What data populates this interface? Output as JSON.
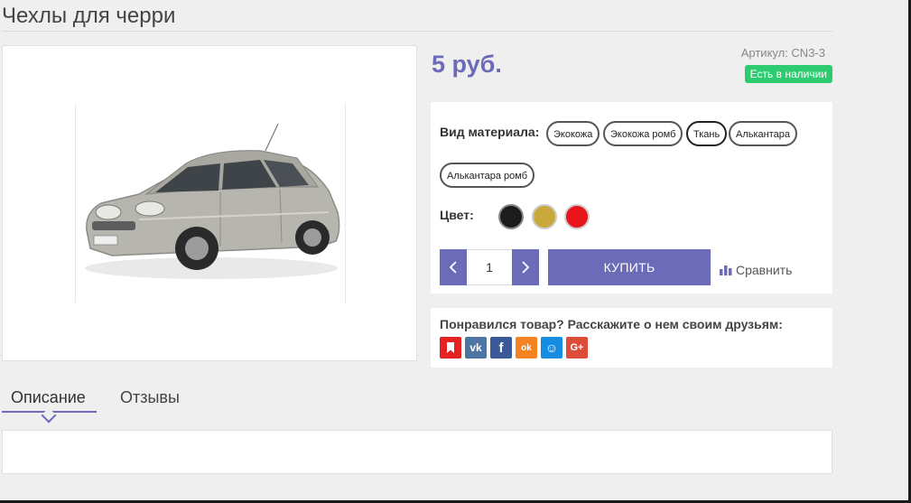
{
  "product": {
    "title": "Чехлы для черри",
    "price": "5 руб.",
    "sku": "Артикул: CN3-3",
    "stock_badge": "Есть в наличии",
    "stock_color": "#2ecc71",
    "accent_color": "#6b6bb8",
    "image_alt": "Chery sedan, silver"
  },
  "options": {
    "material_label": "Вид материала:",
    "materials": [
      "Экокожа",
      "Экокожа ромб",
      "Ткань",
      "Алькантара",
      "Алькантара ромб"
    ],
    "selected_material": "Ткань",
    "color_label": "Цвет:",
    "colors": [
      {
        "name": "black",
        "hex": "#1c1c1c"
      },
      {
        "name": "gold",
        "hex": "#c8a93a"
      },
      {
        "name": "red",
        "hex": "#e8151b"
      }
    ]
  },
  "purchase": {
    "quantity": "1",
    "buy_label": "КУПИТЬ",
    "compare_label": "Сравнить"
  },
  "share": {
    "text": "Понравился товар? Расскажите о нем своим друзьям:",
    "networks": [
      {
        "name": "bookmark",
        "color": "#e52222"
      },
      {
        "name": "vkontakte",
        "color": "#4c75a3",
        "glyph": "vk"
      },
      {
        "name": "facebook",
        "color": "#3b5998",
        "glyph": "f"
      },
      {
        "name": "odnoklassniki",
        "color": "#f58220",
        "glyph": "ok"
      },
      {
        "name": "moi-mir",
        "color": "#168de2",
        "glyph": "☺"
      },
      {
        "name": "google-plus",
        "color": "#dd4b39",
        "glyph": "G+"
      }
    ]
  },
  "tabs": {
    "description": "Описание",
    "reviews": "Отзывы"
  }
}
